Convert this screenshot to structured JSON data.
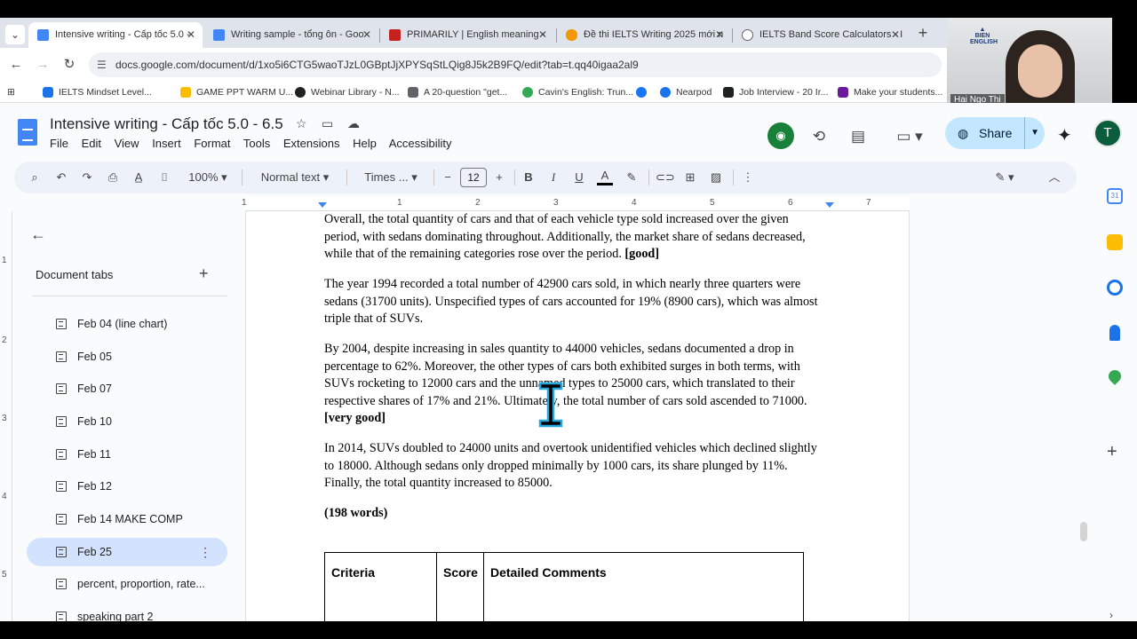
{
  "browser": {
    "tabs": [
      {
        "title": "Intensive writing - Cấp tốc 5.0 -",
        "color": "#4285f4"
      },
      {
        "title": "Writing sample - tổng ôn - Goo",
        "color": "#4285f4"
      },
      {
        "title": "PRIMARILY | English meaning -",
        "color": "#c5221f"
      },
      {
        "title": "Đề thi IELTS Writing 2025 mới n",
        "color": "#f29900"
      },
      {
        "title": "IELTS Band Score Calculators - I",
        "color": "#5f6368"
      }
    ],
    "url": "docs.google.com/document/d/1xo5i6CTG5waoTJzL0GBptJjXPYSqStLQig8J5k2B9FQ/edit?tab=t.qq40igaa2al9",
    "bookmarks": [
      {
        "label": "IELTS Mindset Level...",
        "color": "#1a73e8"
      },
      {
        "label": "GAME PPT WARM U...",
        "color": "#fbbc04"
      },
      {
        "label": "Webinar Library - N...",
        "color": "#202124"
      },
      {
        "label": "A 20-question \"get...",
        "color": "#5f6368"
      },
      {
        "label": "Cavin's English: Trun...",
        "color": "#34a853"
      },
      {
        "label": "",
        "color": "#1877f2"
      },
      {
        "label": "Nearpod",
        "color": "#1a73e8"
      },
      {
        "label": "Job Interview - 20 Ir...",
        "color": "#202124"
      },
      {
        "label": "Make your students...",
        "color": "#6a1b9a"
      }
    ]
  },
  "video": {
    "name": "Hai Ngo Thi",
    "logo": "BIEN ENGLISH"
  },
  "docs": {
    "title": "Intensive writing - Cấp tốc 5.0 - 6.5",
    "menu": [
      "File",
      "Edit",
      "View",
      "Insert",
      "Format",
      "Tools",
      "Extensions",
      "Help",
      "Accessibility"
    ],
    "share_label": "Share",
    "avatar_letter": "T",
    "toolbar": {
      "zoom": "100%",
      "style": "Normal text",
      "font": "Times ...",
      "font_size": "12"
    }
  },
  "ruler": [
    "1",
    "1",
    "2",
    "3",
    "4",
    "5",
    "6",
    "7"
  ],
  "ruler_left": [
    "1",
    "2",
    "3",
    "4",
    "5"
  ],
  "doc_tabs": {
    "title": "Document tabs",
    "items": [
      {
        "label": "Feb 04 (line chart)"
      },
      {
        "label": "Feb 05"
      },
      {
        "label": "Feb 07"
      },
      {
        "label": "Feb 10"
      },
      {
        "label": "Feb 11"
      },
      {
        "label": "Feb 12"
      },
      {
        "label": "Feb 14 MAKE COMP"
      },
      {
        "label": "Feb 25",
        "active": true
      },
      {
        "label": "percent, proportion, rate..."
      },
      {
        "label": "speaking part 2"
      }
    ]
  },
  "content": {
    "p1": "Overall, the total quantity of cars and that of each vehicle type sold increased over the given period, with sedans dominating throughout. Additionally, the market share of sedans decreased, while that of the remaining categories rose over the period.",
    "p1_tag": "[good]",
    "p2": "The year 1994 recorded a total number of 42900 cars sold, in which nearly three quarters were sedans (31700 units). Unspecified types of cars accounted for 19% (8900 cars), which was almost triple that of SUVs.",
    "p3": "By 2004, despite increasing in sales quantity to 44000 vehicles, sedans documented a drop in percentage to 62%. Moreover, the other types of cars both exhibited surges in both terms, with SUVs rocketing to 12000 cars and the unnamed types to 25000 cars, which translated to their respective shares of 17% and 21%. Ultimately, the total number of cars sold ascended to 71000.",
    "p3_tag": "[very good]",
    "p4": "In 2014, SUVs doubled to 24000 units and overtook unidentified vehicles which declined slightly to 18000. Although sedans only dropped minimally by 1000 cars, its share plunged by 11%. Finally, the total quantity increased to 85000.",
    "word_count": "(198 words)",
    "table_headers": [
      "Criteria",
      "Score",
      "Detailed Comments"
    ]
  }
}
